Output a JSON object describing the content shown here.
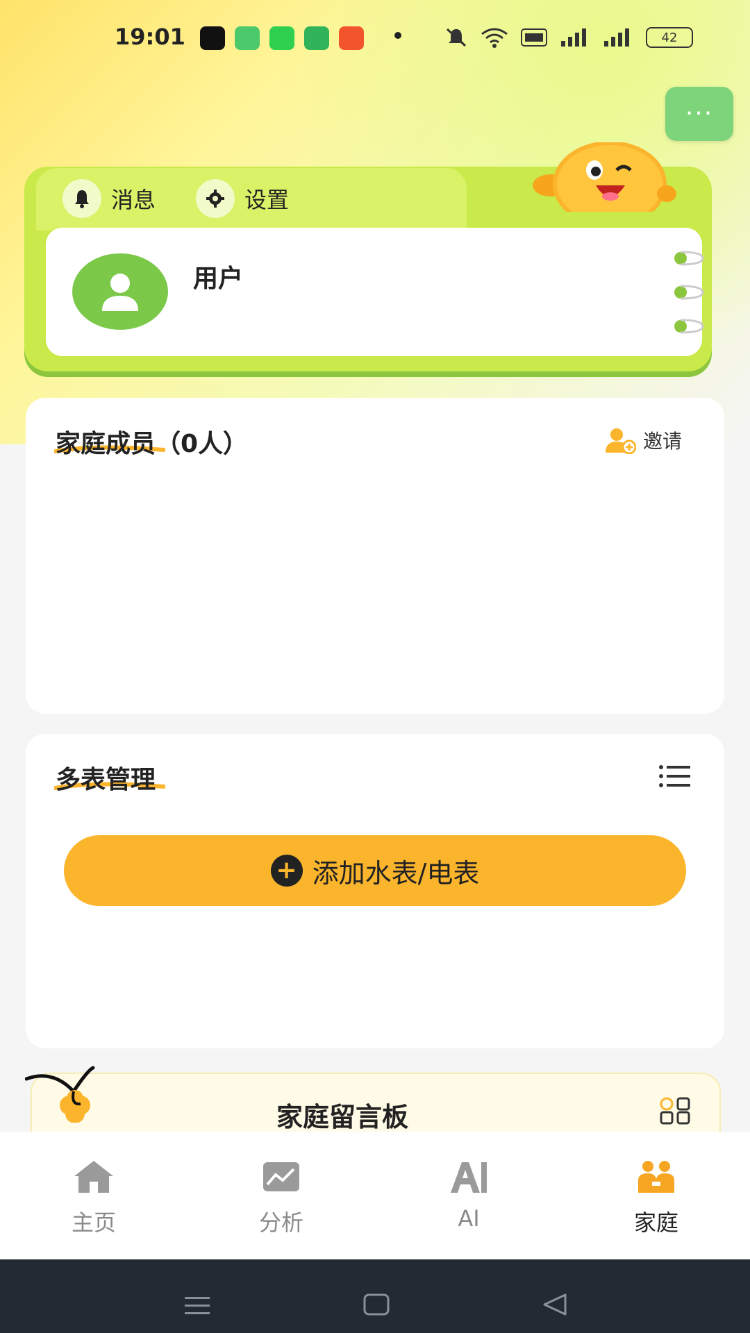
{
  "status_bar": {
    "time": "19:01",
    "battery": "42",
    "app_icons": [
      {
        "name": "tiktok-icon",
        "color": "#111111"
      },
      {
        "name": "messages-icon",
        "color": "#4cc96a"
      },
      {
        "name": "wechat-icon",
        "color": "#2fd050"
      },
      {
        "name": "shield-app-icon",
        "color": "#31b35a"
      },
      {
        "name": "app-red-icon",
        "color": "#f2552c"
      }
    ]
  },
  "user_card": {
    "messages_label": "消息",
    "settings_label": "设置",
    "user_name": "用户"
  },
  "family_members": {
    "title": "家庭成员（0人）",
    "invite_label": "邀请"
  },
  "meter_management": {
    "title": "多表管理",
    "add_button_label": "添加水表/电表"
  },
  "message_board": {
    "title": "家庭留言板"
  },
  "tabs": [
    {
      "label": "主页",
      "icon": "home-icon"
    },
    {
      "label": "分析",
      "icon": "chart-icon"
    },
    {
      "label": "AI",
      "icon": "ai-icon"
    },
    {
      "label": "家庭",
      "icon": "family-icon",
      "active": true
    }
  ],
  "colors": {
    "accent_green": "#c9ea4a",
    "menu_green": "#7ed47b",
    "accent_orange": "#fbb52d",
    "tab_active": "#f6a623",
    "tab_inactive": "#9a9a9a",
    "nav_bar": "#222a33"
  }
}
